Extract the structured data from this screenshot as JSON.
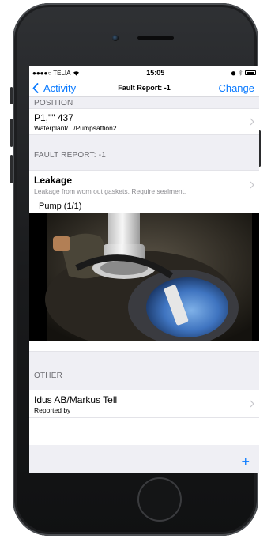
{
  "status_bar": {
    "carrier": "●●●●○ TELIA",
    "time": "15:05"
  },
  "nav": {
    "back_label": "Activity",
    "title": "Fault Report: -1",
    "action_label": "Change"
  },
  "position": {
    "header": "POSITION",
    "title": "P1,\"\" 437",
    "subtitle": "Waterplant/.../Pumpsattion2"
  },
  "fault_report": {
    "header": "FAULT REPORT: -1",
    "title": "Leakage",
    "description": "Leakage from worn out gaskets. Require sealment.",
    "attachment_label": "Pump (1/1)"
  },
  "other": {
    "header": "OTHER",
    "name": "Idus AB/Markus Tell",
    "role": "Reported by"
  },
  "colors": {
    "accent": "#0a7aff",
    "group_bg": "#efeff4"
  },
  "icons": {
    "back": "chevron-left-icon",
    "disclosure": "chevron-right-icon",
    "add": "plus-icon"
  }
}
